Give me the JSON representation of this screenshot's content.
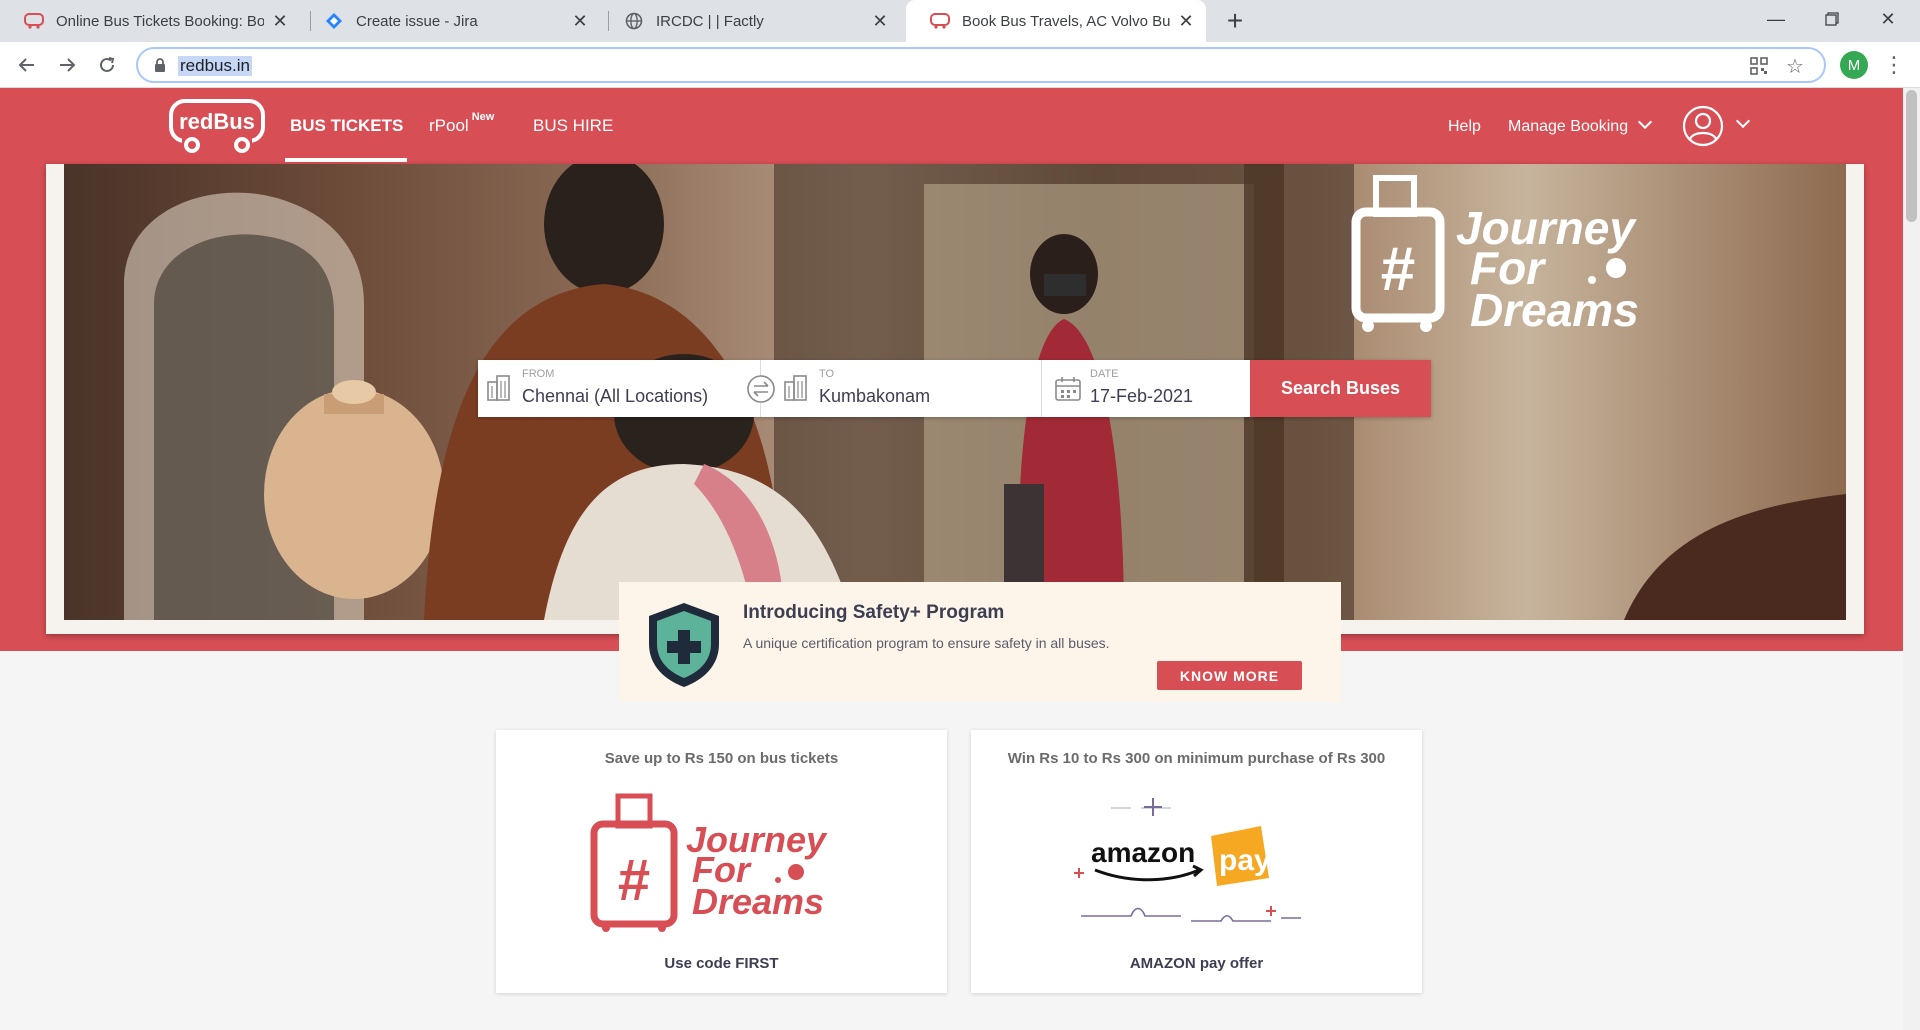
{
  "browser": {
    "tabs": [
      {
        "title": "Online Bus Tickets Booking: Book",
        "icon": "redbus-favicon"
      },
      {
        "title": "Create issue - Jira",
        "icon": "jira-favicon"
      },
      {
        "title": "IRCDC | | Factly",
        "icon": "globe-icon"
      },
      {
        "title": "Book Bus Travels, AC Volvo Bus, r",
        "icon": "redbus-favicon",
        "active": true
      }
    ],
    "url": "redbus.in",
    "profile_initial": "M"
  },
  "header": {
    "logo_text": "redBus",
    "nav": [
      {
        "label": "BUS TICKETS",
        "active": true
      },
      {
        "label": "rPool",
        "badge": "New"
      },
      {
        "label": "BUS HIRE"
      }
    ],
    "help": "Help",
    "manage_booking": "Manage Booking"
  },
  "hero": {
    "brand_line1": "Journey",
    "brand_line2": "For",
    "brand_line3": "Dreams",
    "hash": "#"
  },
  "search": {
    "from_label": "FROM",
    "from_value": "Chennai (All Locations)",
    "to_label": "TO",
    "to_value": "Kumbakonam",
    "date_label": "DATE",
    "date_value": "17-Feb-2021",
    "button": "Search Buses"
  },
  "safety": {
    "title": "Introducing Safety+ Program",
    "description": "A unique certification program to ensure safety in all buses.",
    "button": "KNOW MORE"
  },
  "offers": [
    {
      "headline": "Save up to Rs 150 on bus tickets",
      "footer": "Use code FIRST",
      "brand1": "Journey",
      "brand2": "For",
      "brand3": "Dreams"
    },
    {
      "headline": "Win Rs 10 to Rs 300 on minimum purchase of Rs 300",
      "footer": "AMAZON pay offer",
      "amazon": "amazon",
      "pay": "pay"
    }
  ],
  "colors": {
    "brand_red": "#d84e55",
    "banner_bg": "#fdf5e9",
    "amazon_orange": "#f7a823"
  }
}
